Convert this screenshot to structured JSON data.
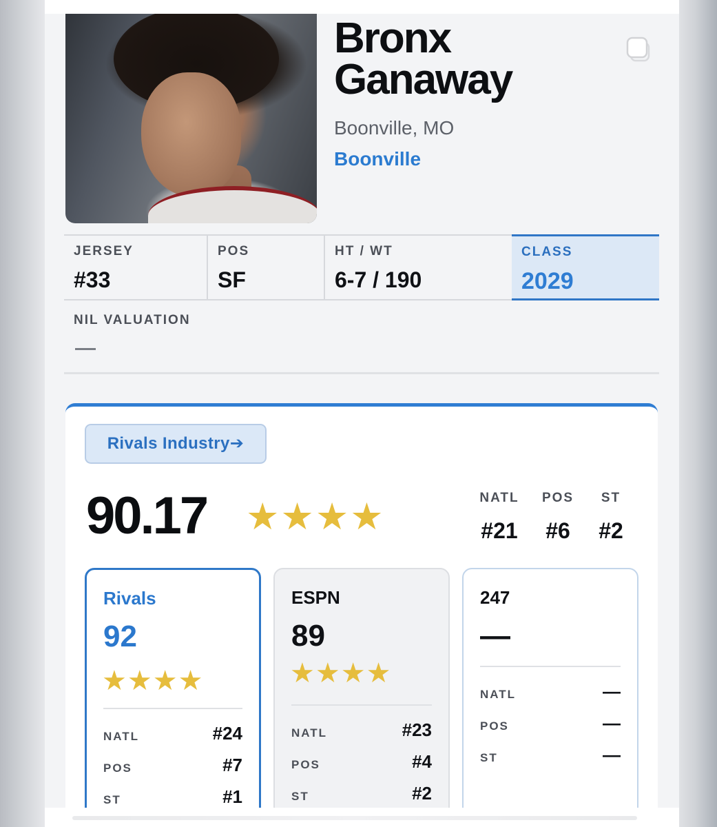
{
  "profile": {
    "first_name": "Bronx",
    "last_name": "Ganaway",
    "hometown": "Boonville, MO",
    "school": "Boonville"
  },
  "attributes": [
    {
      "label": "JERSEY",
      "value": "#33"
    },
    {
      "label": "POS",
      "value": "SF"
    },
    {
      "label": "HT / WT",
      "value": "6-7 / 190"
    },
    {
      "label": "CLASS",
      "value": "2029"
    }
  ],
  "nil": {
    "label": "NIL VALUATION",
    "value": "—"
  },
  "rankings": {
    "source_button": "Rivals Industry",
    "composite_score": "90.17",
    "composite_stars": "★★★★",
    "star_count": 4,
    "summary": [
      {
        "label": "NATL",
        "value": "#21"
      },
      {
        "label": "POS",
        "value": "#6"
      },
      {
        "label": "ST",
        "value": "#2"
      }
    ],
    "services": [
      {
        "name": "Rivals",
        "score": "92",
        "stars": "★★★★",
        "ranks": [
          {
            "label": "NATL",
            "value": "#24"
          },
          {
            "label": "POS",
            "value": "#7"
          },
          {
            "label": "ST",
            "value": "#1"
          }
        ]
      },
      {
        "name": "ESPN",
        "score": "89",
        "stars": "★★★★",
        "ranks": [
          {
            "label": "NATL",
            "value": "#23"
          },
          {
            "label": "POS",
            "value": "#4"
          },
          {
            "label": "ST",
            "value": "#2"
          }
        ]
      },
      {
        "name": "247",
        "score": "—",
        "stars": "",
        "ranks": [
          {
            "label": "NATL",
            "value": "—"
          },
          {
            "label": "POS",
            "value": "—"
          },
          {
            "label": "ST",
            "value": "—"
          }
        ]
      }
    ]
  },
  "colors": {
    "accent": "#2f7dd3",
    "star": "#e6bd3d",
    "text": "#0f1115"
  }
}
